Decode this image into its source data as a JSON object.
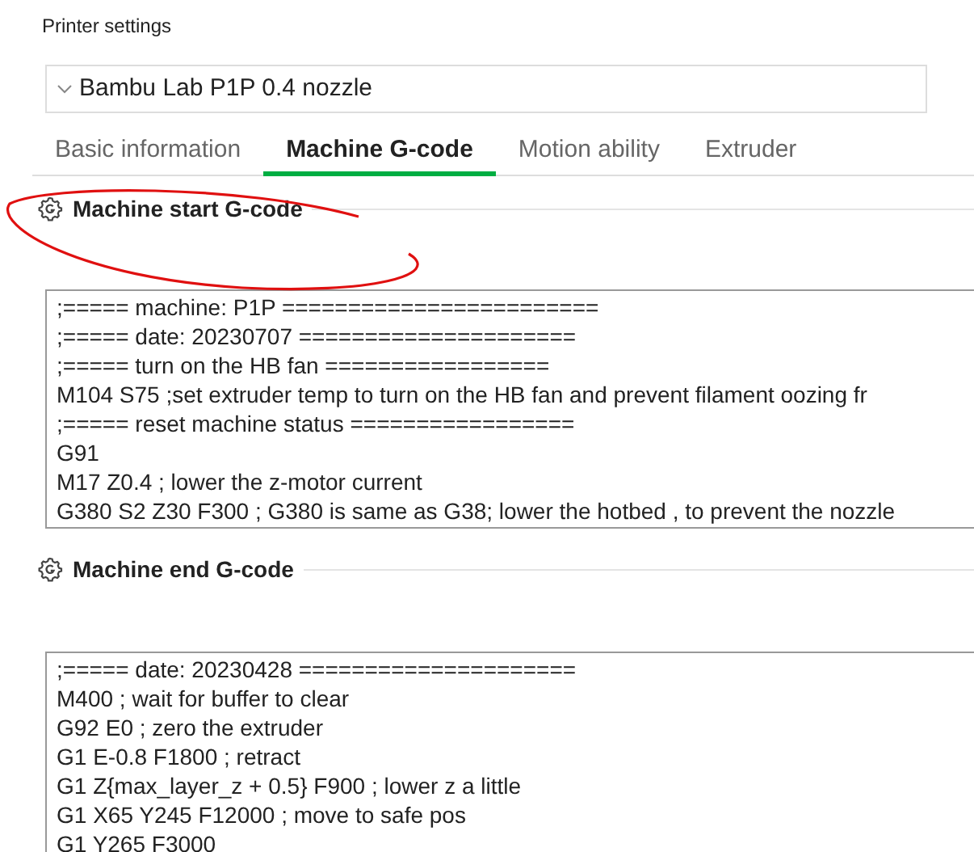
{
  "window": {
    "title": "Printer settings"
  },
  "printer_dropdown": {
    "value": "Bambu Lab P1P 0.4 nozzle"
  },
  "tabs": [
    {
      "label": "Basic information",
      "selected": false
    },
    {
      "label": "Machine G-code",
      "selected": true
    },
    {
      "label": "Motion ability",
      "selected": false
    },
    {
      "label": "Extruder",
      "selected": false
    }
  ],
  "sections": [
    {
      "title": "Machine start G-code",
      "annotated": true,
      "lines": [
        ";===== machine: P1P ========================",
        ";===== date: 20230707 =====================",
        ";===== turn on the HB fan =================",
        "M104 S75 ;set extruder temp to turn on the HB fan and prevent filament oozing fr",
        ";===== reset machine status =================",
        "G91",
        "M17 Z0.4 ; lower the z-motor current",
        "G380 S2 Z30 F300 ; G380 is same as G38; lower the hotbed , to prevent the nozzle"
      ]
    },
    {
      "title": "Machine end G-code",
      "annotated": false,
      "lines": [
        ";===== date: 20230428 =====================",
        "M400 ; wait for buffer to clear",
        "G92 E0 ; zero the extruder",
        "G1 E-0.8 F1800 ; retract",
        "G1 Z{max_layer_z + 0.5} F900 ; lower z a little",
        "G1 X65 Y245 F12000 ; move to safe pos",
        "G1 Y265 F3000"
      ]
    }
  ]
}
